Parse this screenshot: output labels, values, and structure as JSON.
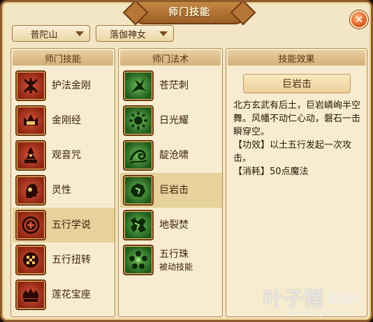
{
  "window": {
    "title": "师门技能"
  },
  "filters": {
    "sect": "普陀山",
    "role": "落伽神女"
  },
  "panels": {
    "skills_header": "师门技能",
    "spells_header": "师门法术",
    "effect_header": "技能效果"
  },
  "skills": [
    {
      "label": "护法金刚",
      "icon": "vajra-icon"
    },
    {
      "label": "金刚经",
      "icon": "crown-icon"
    },
    {
      "label": "观音咒",
      "icon": "pagoda-icon"
    },
    {
      "label": "灵性",
      "icon": "head-profile-icon"
    },
    {
      "label": "五行学说",
      "icon": "five-elements-disc-icon",
      "selected": true
    },
    {
      "label": "五行扭转",
      "icon": "checker-disc-icon"
    },
    {
      "label": "莲花宝座",
      "icon": "lotus-throne-icon"
    }
  ],
  "spells": [
    {
      "label": "苍茫刺",
      "icon": "thorn-icon"
    },
    {
      "label": "日光耀",
      "icon": "sun-icon"
    },
    {
      "label": "靛沧啸",
      "icon": "wave-icon"
    },
    {
      "label": "巨岩击",
      "icon": "boulder-icon",
      "selected": true
    },
    {
      "label": "地裂焚",
      "icon": "ground-fissure-icon"
    },
    {
      "label": "五行珠",
      "sublabel": "被动技能",
      "icon": "five-orbs-icon"
    }
  ],
  "effect": {
    "name": "巨岩击",
    "description": "北方玄武有后土，巨岩嶙峋半空舞。风幡不动仁心动，磐石一击瞬穿空。",
    "function": "【功效】以土五行发起一次攻击。",
    "cost": "【消耗】50点魔法"
  },
  "watermark": {
    "main": "叶子猪",
    "sub": "游戏网",
    "url": "www.yzz.cn"
  }
}
